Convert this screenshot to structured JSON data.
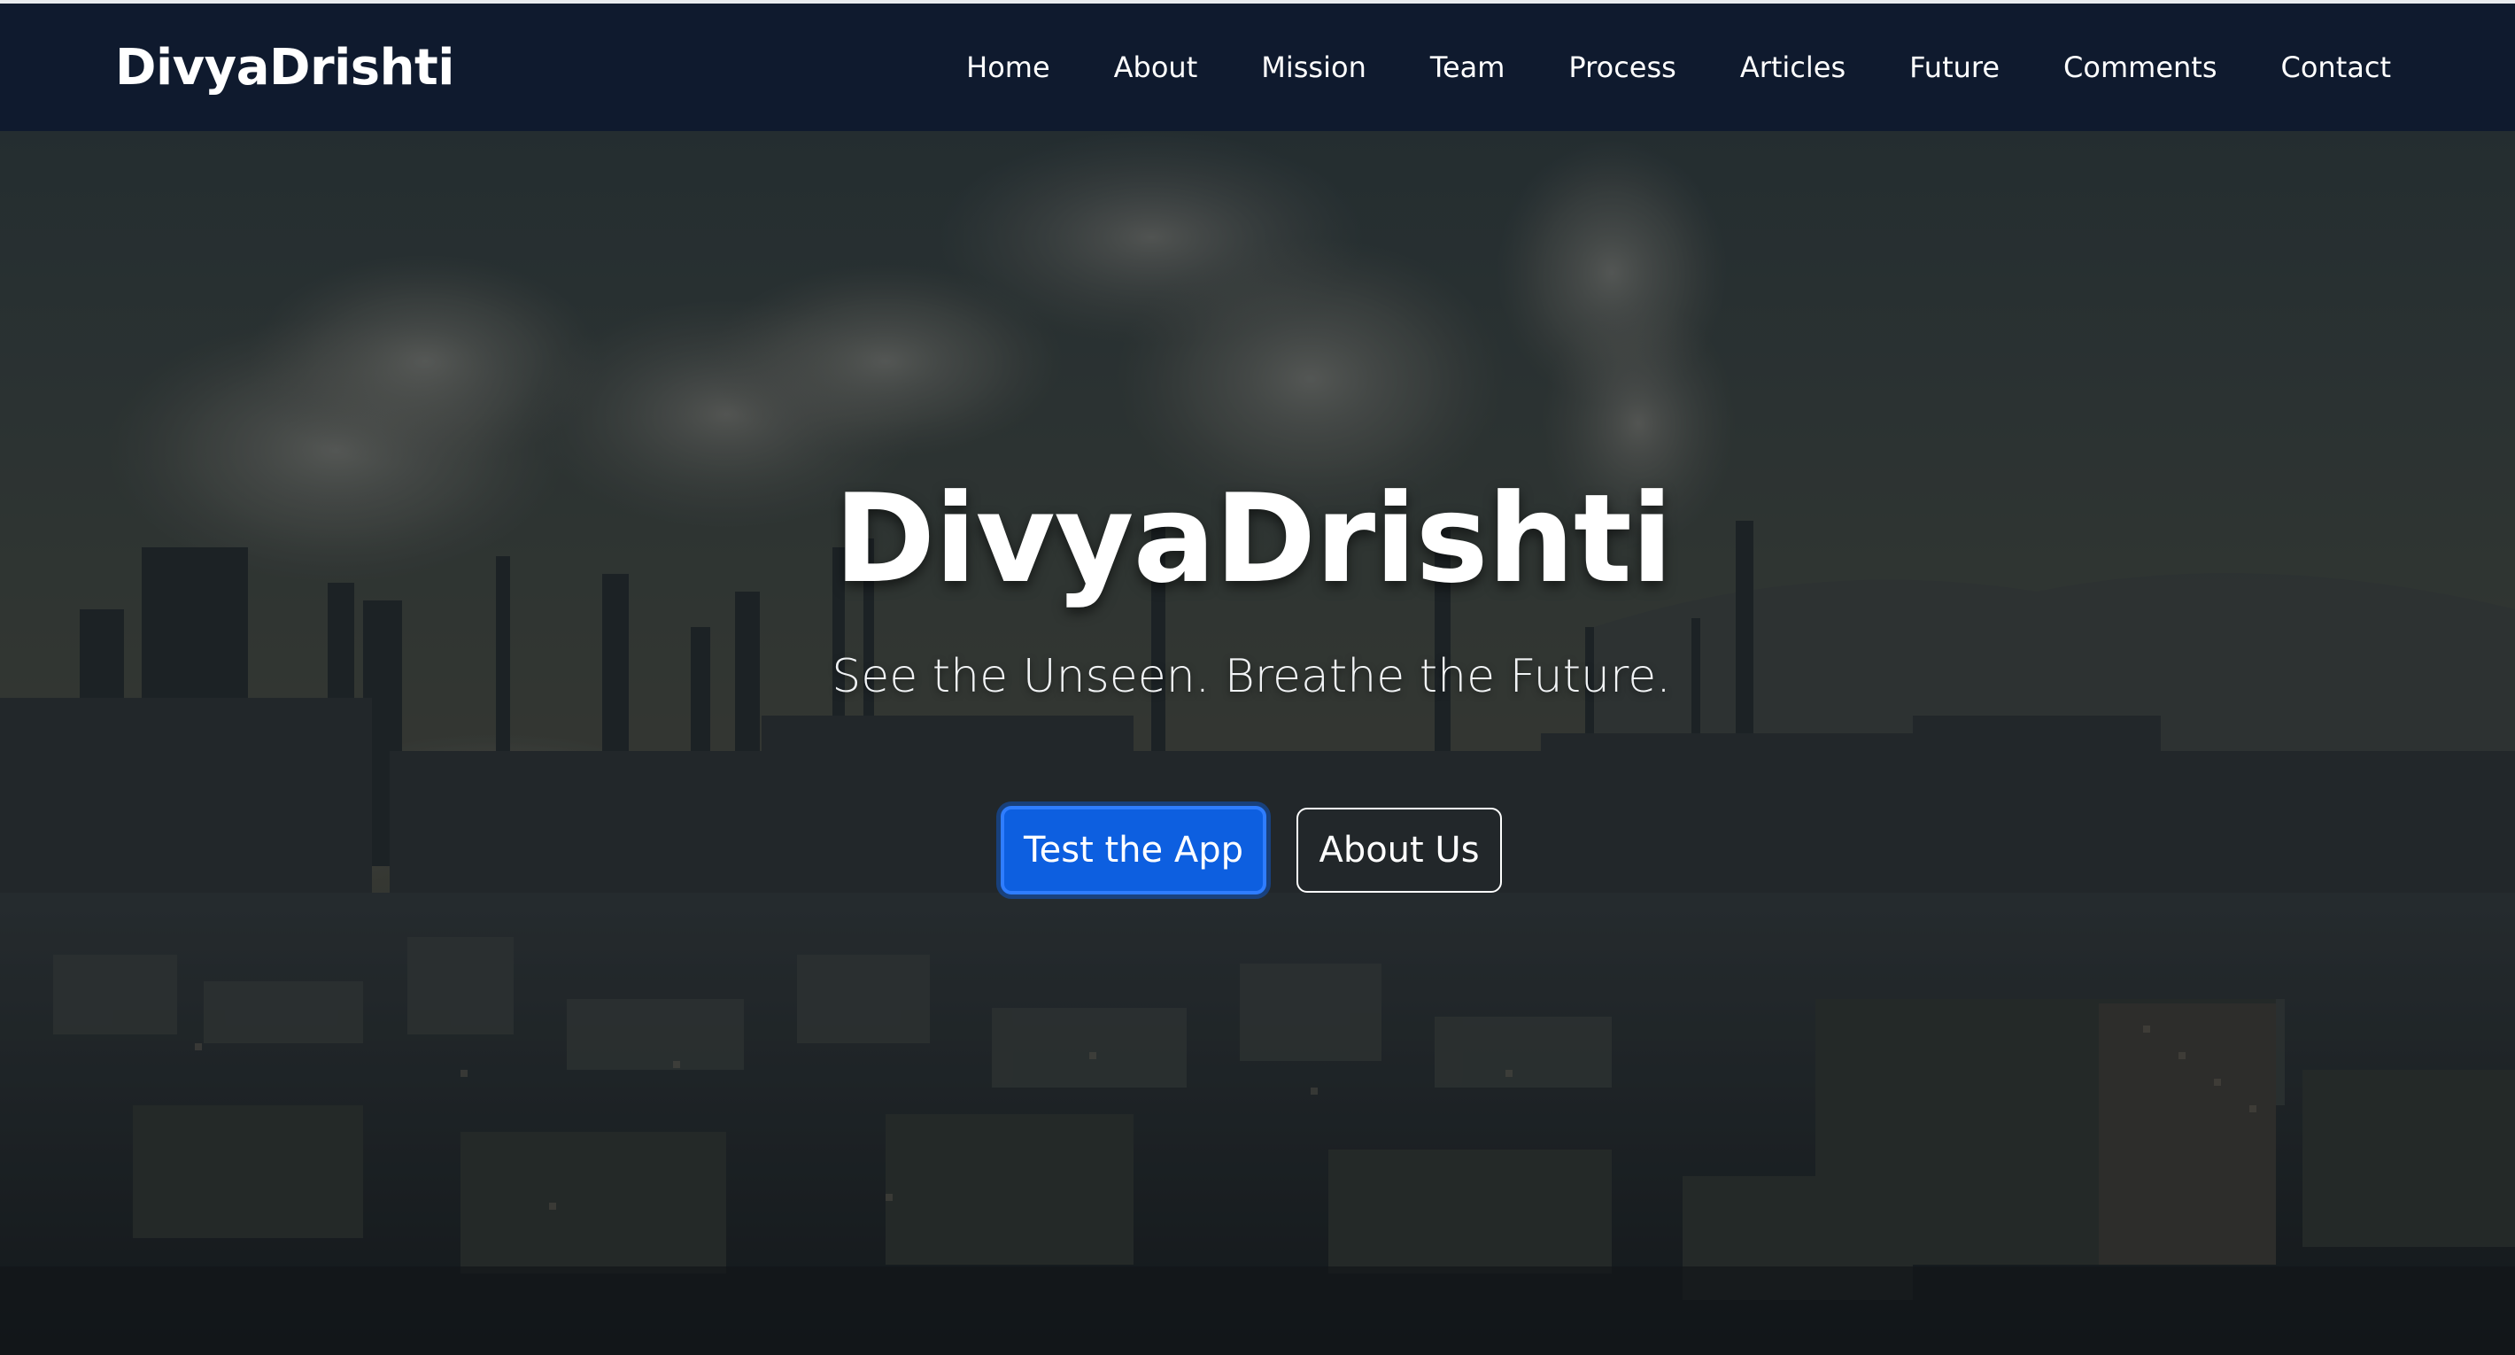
{
  "navbar": {
    "brand": "DivyaDrishti",
    "links": [
      "Home",
      "About",
      "Mission",
      "Team",
      "Process",
      "Articles",
      "Future",
      "Comments",
      "Contact"
    ]
  },
  "hero": {
    "title": "DivyaDrishti",
    "tagline": "See the Unseen. Breathe the Future.",
    "primary_button": "Test the App",
    "secondary_button": "About Us"
  },
  "colors": {
    "navbar_bg": "#0f1a2e",
    "primary_button": "#0d5fe0",
    "text": "#ffffff"
  }
}
